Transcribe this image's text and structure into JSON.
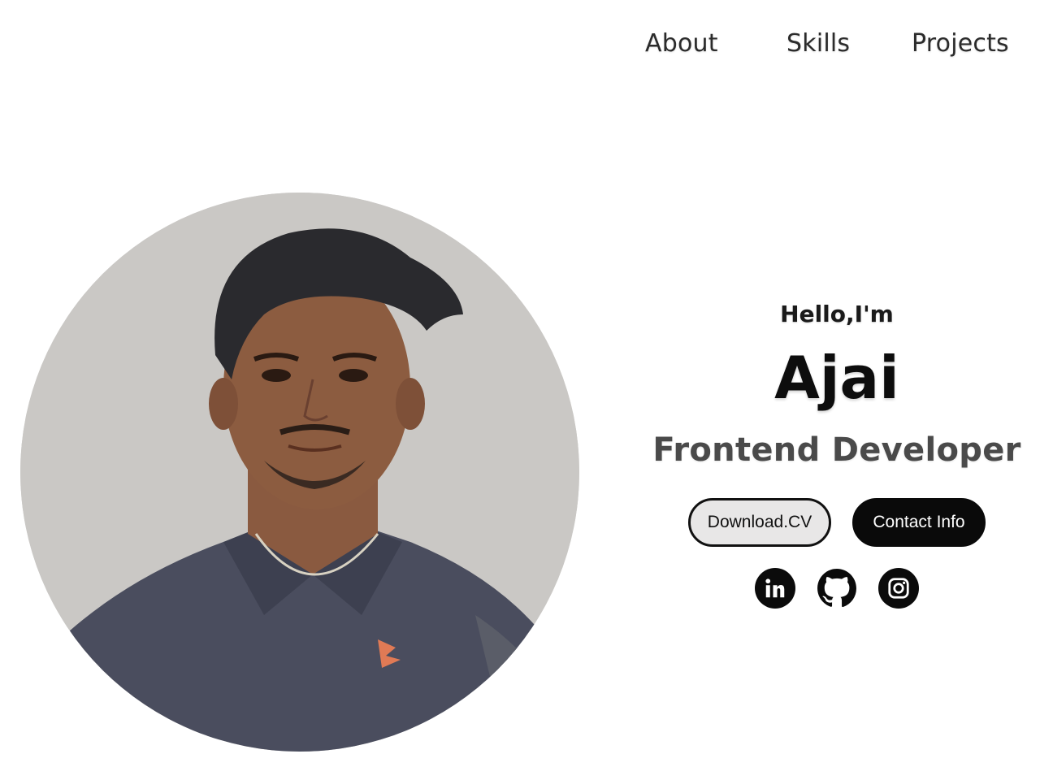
{
  "nav": {
    "items": [
      {
        "label": "About"
      },
      {
        "label": "Skills"
      },
      {
        "label": "Projects"
      }
    ]
  },
  "hero": {
    "greeting": "Hello,I'm",
    "name": "Ajai",
    "role": "Frontend Developer",
    "buttons": {
      "download_label": "Download.CV",
      "contact_label": "Contact Info"
    },
    "socials": [
      {
        "icon": "linkedin-icon"
      },
      {
        "icon": "github-icon"
      },
      {
        "icon": "instagram-icon"
      }
    ]
  },
  "colors": {
    "photo_background": "#cac8c5",
    "primary_dark": "#0a0a0a",
    "role_text": "#4a4a4a"
  }
}
